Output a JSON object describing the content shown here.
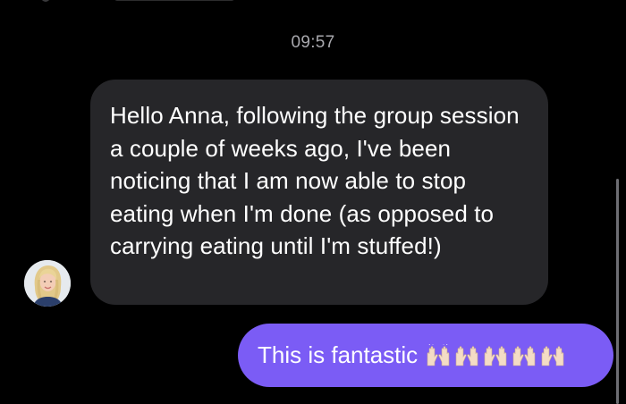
{
  "conversation": {
    "timestamp": "09:57",
    "incoming_message": {
      "text": "Hello Anna, following the group session a couple of weeks ago, I've been noticing that I am now able to stop eating when I'm done (as opposed to carrying eating until I'm stuffed!)",
      "sender_avatar": "avatar-photo"
    },
    "outgoing_message": {
      "text": "This is fantastic",
      "emojis": [
        "raising-hands-emoji",
        "raising-hands-emoji",
        "raising-hands-emoji",
        "raising-hands-emoji",
        "raising-hands-emoji"
      ]
    }
  },
  "colors": {
    "background": "#000000",
    "incoming_bubble": "#262629",
    "outgoing_bubble": "#7b5cf5",
    "timestamp_text": "#a9a9ae",
    "message_text": "#ffffff",
    "scrollbar": "#6e6e73"
  }
}
